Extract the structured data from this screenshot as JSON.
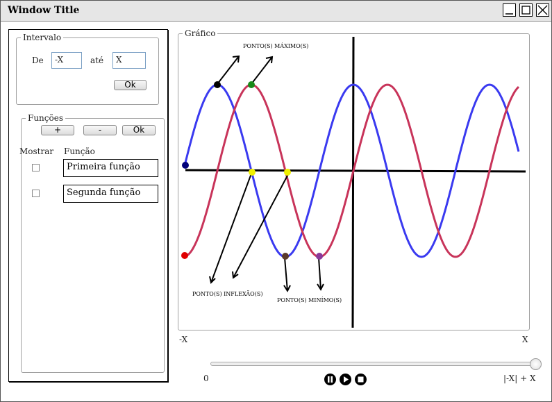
{
  "window": {
    "title": "Window Title"
  },
  "interval": {
    "legend": "Intervalo",
    "from_label": "De",
    "from_value": "-X",
    "to_label": "até",
    "to_value": "X",
    "ok_label": "Ok"
  },
  "functions": {
    "legend": "Funções",
    "add_label": "+",
    "remove_label": "-",
    "ok_label": "Ok",
    "col_show": "Mostrar",
    "col_function": "Função",
    "items": [
      {
        "name": "Primeira função",
        "checked": false
      },
      {
        "name": "Segunda função",
        "checked": false
      }
    ]
  },
  "graph": {
    "legend": "Gráfico",
    "annotations": {
      "maxima": "PONTO(S) MÁXIMO(S)",
      "inflection": "PONTO(S) INFLEXÃO(S)",
      "minima": "PONTO(S) MINÍMO(S)"
    },
    "x_min_label": "-X",
    "x_max_label": "X",
    "colors": {
      "series_1": "#3a3af0",
      "series_2": "#c8345a",
      "max_1": "#000000",
      "max_2": "#1a8a1a",
      "inflection": "#f0f000",
      "start_1": "#00007a",
      "start_2": "#e00000",
      "min_1": "#5a3a2a",
      "min_2": "#8a3a9a"
    }
  },
  "playback": {
    "start_label": "0",
    "end_label": "|-X| + X",
    "position": 1.0,
    "icons": [
      "pause-icon",
      "play-icon",
      "stop-icon"
    ]
  }
}
